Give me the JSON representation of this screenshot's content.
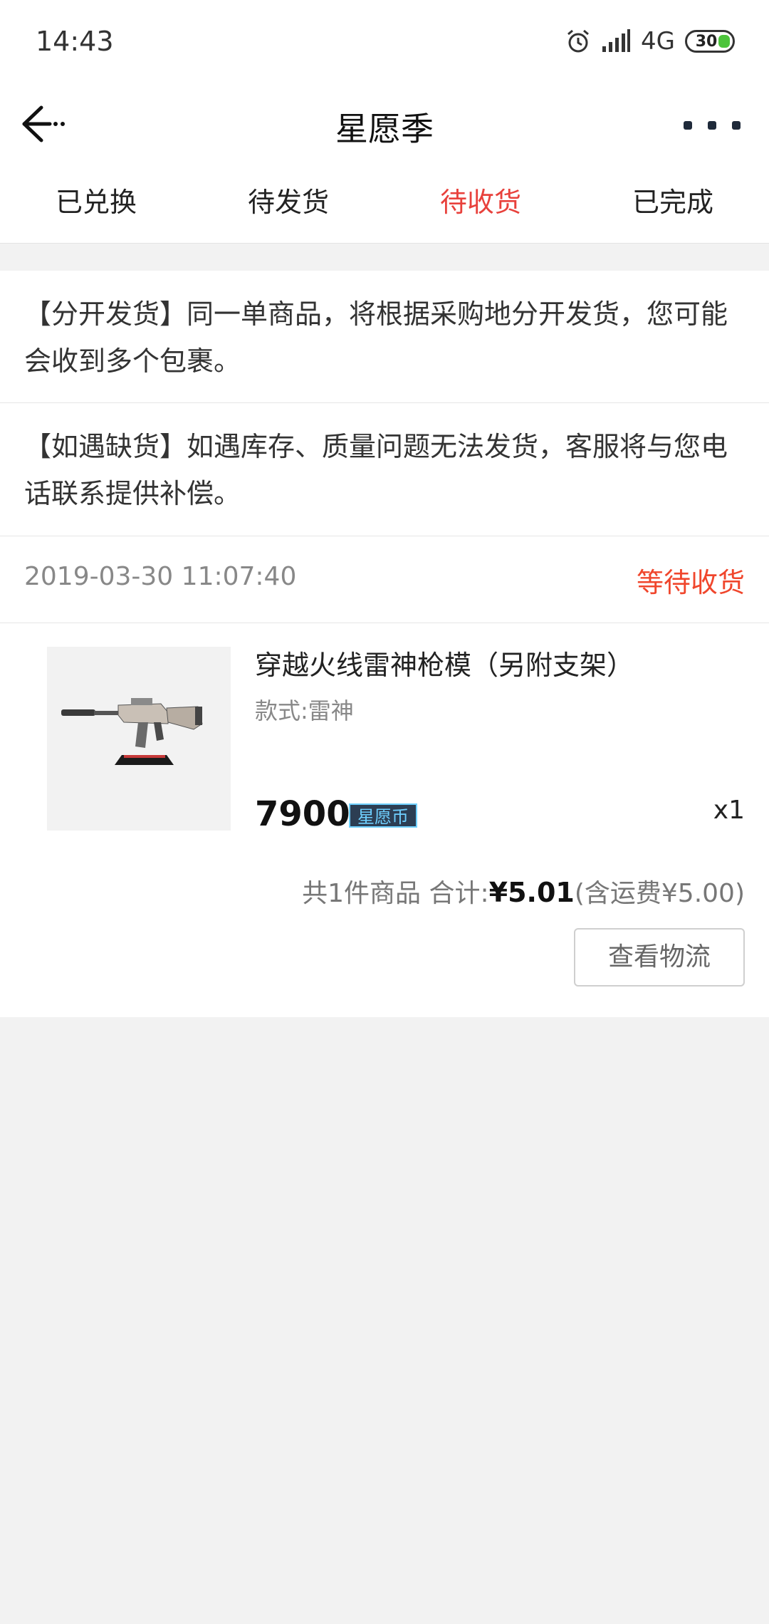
{
  "status_bar": {
    "time": "14:43",
    "network": "4G",
    "battery": "30",
    "icons": [
      "alarm-icon",
      "signal-icon",
      "battery-icon"
    ]
  },
  "nav": {
    "title": "星愿季",
    "back_icon": "back-arrow-icon",
    "more_icon": "more-icon"
  },
  "tabs": [
    {
      "label": "已兑换",
      "active": false
    },
    {
      "label": "待发货",
      "active": false
    },
    {
      "label": "待收货",
      "active": true
    },
    {
      "label": "已完成",
      "active": false
    }
  ],
  "notices": [
    {
      "text": "【分开发货】同一单商品，将根据采购地分开发货，您可能会收到多个包裹。"
    },
    {
      "text": "【如遇缺货】如遇库存、质量问题无法发货，客服将与您电话联系提供补偿。"
    }
  ],
  "order": {
    "time": "2019-03-30 11:07:40",
    "status": "等待收货",
    "product": {
      "name": "穿越火线雷神枪模（另附支架）",
      "variant": "款式:雷神",
      "price": "7900",
      "currency_badge": "星愿币",
      "quantity": "x1"
    },
    "summary": {
      "count_text": "共1件商品 合计: ",
      "total": "¥5.01",
      "shipping_note": "(含运费¥5.00)"
    },
    "logistics_button": "查看物流"
  },
  "colors": {
    "accent": "#e8413c",
    "status": "#f0462c",
    "background": "#f2f2f2"
  }
}
